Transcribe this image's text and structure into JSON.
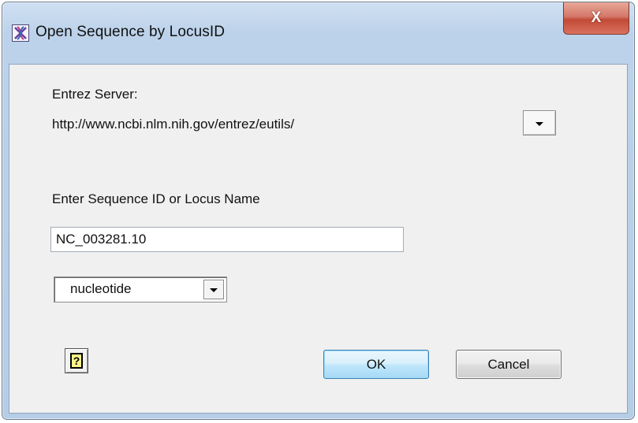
{
  "window": {
    "title": "Open Sequence by LocusID",
    "close_glyph": "X",
    "icon": "app-icon"
  },
  "server": {
    "label": "Entrez Server:",
    "url": "http://www.ncbi.nlm.nih.gov/entrez/eutils/"
  },
  "sequence": {
    "label": "Enter Sequence ID or Locus Name",
    "value": "NC_003281.10"
  },
  "database": {
    "selected": "nucleotide"
  },
  "buttons": {
    "help_glyph": "?",
    "ok": "OK",
    "cancel": "Cancel"
  }
}
